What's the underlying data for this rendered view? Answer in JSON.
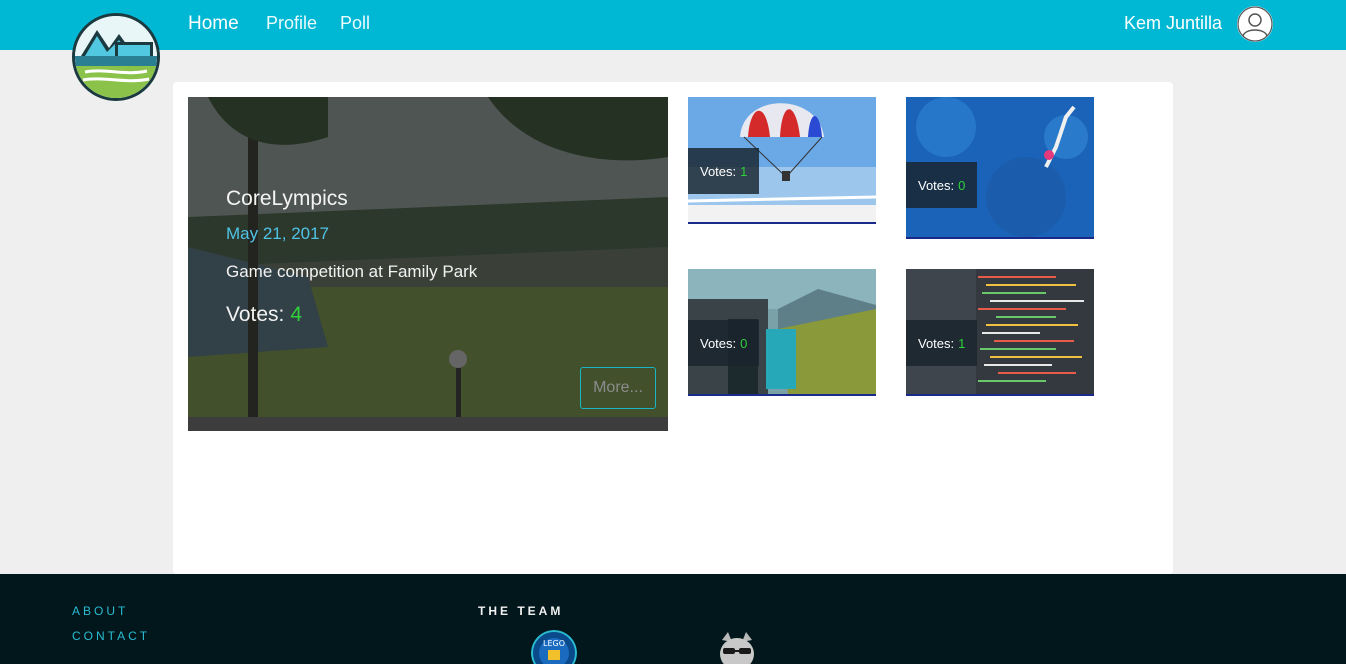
{
  "nav": {
    "links": [
      "Home",
      "Profile",
      "Poll"
    ],
    "user_name": "Kem Juntilla"
  },
  "featured": {
    "title": "CoreLympics",
    "date": "May 21, 2017",
    "description": "Game competition at Family Park",
    "votes_label": "Votes:",
    "votes": "4",
    "more_label": "More..."
  },
  "thumbnails": [
    {
      "votes_label": "Votes:",
      "votes": "1"
    },
    {
      "votes_label": "Votes:",
      "votes": "0"
    },
    {
      "votes_label": "Votes:",
      "votes": "0"
    },
    {
      "votes_label": "Votes:",
      "votes": "1"
    }
  ],
  "footer": {
    "about": "ABOUT",
    "contact": "CONTACT",
    "team_title": "THE TEAM",
    "team_badge_text": "LEGO"
  },
  "colors": {
    "nav_bg": "#00b8d4",
    "accent": "#29bcd2",
    "vote_green": "#2fd13a",
    "footer_bg": "#02171c"
  },
  "icons": {
    "logo": "mountain-lake-logo",
    "user": "user-avatar-icon"
  }
}
